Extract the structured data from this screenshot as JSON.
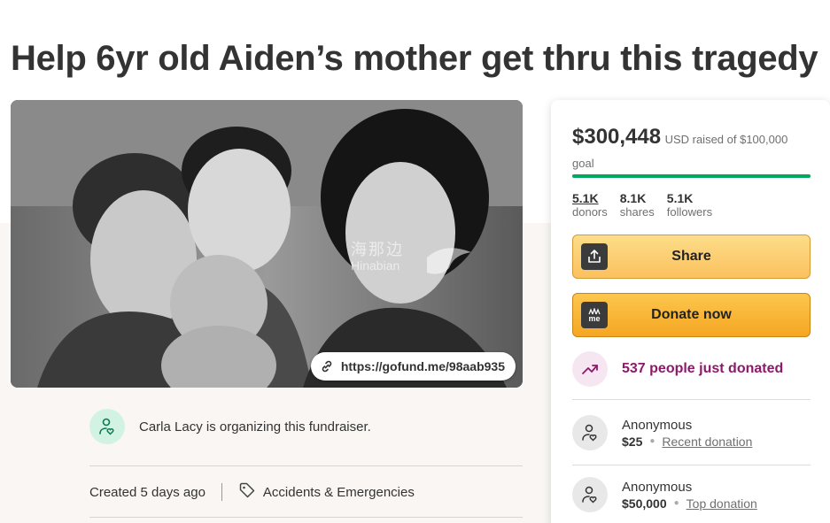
{
  "page": {
    "title": "Help 6yr old Aiden’s mother get thru this tragedy"
  },
  "hero": {
    "short_link": "https://gofund.me/98aab935",
    "watermark_cn": "海那边",
    "watermark_en": "Hinabian"
  },
  "organizer": {
    "text": "Carla Lacy is organizing this fundraiser."
  },
  "meta": {
    "created": "Created 5 days ago",
    "category": "Accidents & Emergencies"
  },
  "donate_card": {
    "amount_raised": "$300,448",
    "goal_text": "USD raised of $100,000 goal",
    "progress_fraction": 1.0,
    "stats": [
      {
        "value": "5.1K",
        "label": "donors"
      },
      {
        "value": "8.1K",
        "label": "shares"
      },
      {
        "value": "5.1K",
        "label": "followers"
      }
    ],
    "share_label": "Share",
    "donate_label": "Donate now",
    "donate_icon_text": "me",
    "recent_text": "537 people just donated",
    "donations": [
      {
        "name": "Anonymous",
        "amount": "$25",
        "tag": "Recent donation"
      },
      {
        "name": "Anonymous",
        "amount": "$50,000",
        "tag": "Top donation"
      }
    ]
  },
  "colors": {
    "progress_green": "#02a95c",
    "button_yellow": "#fbc15e",
    "trend_purple": "#8c1a6a",
    "organizer_icon_bg": "#d2f3e4"
  }
}
